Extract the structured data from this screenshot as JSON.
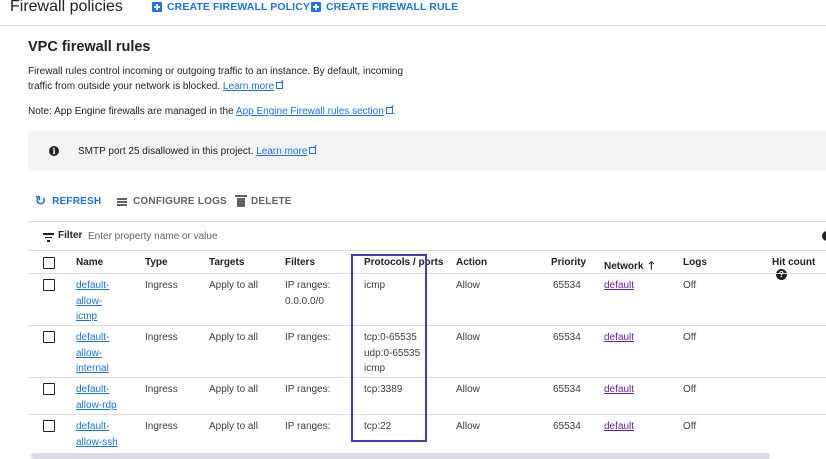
{
  "header": {
    "title": "Firewall policies",
    "create_policy_label": "CREATE FIREWALL POLICY",
    "create_rule_label": "CREATE FIREWALL RULE"
  },
  "section": {
    "title": "VPC firewall rules",
    "description_line1": "Firewall rules control incoming or outgoing traffic to an instance. By default, incoming",
    "description_line2": "traffic from outside your network is blocked.",
    "learn_more": "Learn more",
    "note_prefix": "Note: App Engine firewalls are managed in the",
    "note_link": "App Engine Firewall rules section",
    "note_suffix": "."
  },
  "banner": {
    "text": "SMTP port 25 disallowed in this project.",
    "learn_more": "Learn more"
  },
  "toolbar": {
    "refresh": "REFRESH",
    "configure_logs": "CONFIGURE LOGS",
    "delete": "DELETE"
  },
  "filter": {
    "label": "Filter",
    "placeholder": "Enter property name or value"
  },
  "table": {
    "columns": {
      "name": "Name",
      "type": "Type",
      "targets": "Targets",
      "filters": "Filters",
      "protocols": "Protocols / ports",
      "action": "Action",
      "priority": "Priority",
      "network": "Network",
      "logs": "Logs",
      "hit_count": "Hit count"
    },
    "rows": [
      {
        "name": [
          "default-",
          "allow-",
          "icmp"
        ],
        "type": "Ingress",
        "targets": "Apply to all",
        "filters": [
          "IP ranges:",
          "0.0.0.0/0"
        ],
        "protocols": [
          "icmp"
        ],
        "action": "Allow",
        "priority": "65534",
        "network": "default",
        "logs": "Off"
      },
      {
        "name": [
          "default-",
          "allow-",
          "internal"
        ],
        "type": "Ingress",
        "targets": "Apply to all",
        "filters": [
          "IP ranges:"
        ],
        "protocols": [
          "tcp:0-65535",
          "udp:0-65535",
          "icmp"
        ],
        "action": "Allow",
        "priority": "65534",
        "network": "default",
        "logs": "Off"
      },
      {
        "name": [
          "default-",
          "allow-rdp"
        ],
        "type": "Ingress",
        "targets": "Apply to all",
        "filters": [
          "IP ranges:"
        ],
        "protocols": [
          "tcp:3389"
        ],
        "action": "Allow",
        "priority": "65534",
        "network": "default",
        "logs": "Off"
      },
      {
        "name": [
          "default-",
          "allow-ssh"
        ],
        "type": "Ingress",
        "targets": "Apply to all",
        "filters": [
          "IP ranges:"
        ],
        "protocols": [
          "tcp:22"
        ],
        "action": "Allow",
        "priority": "65534",
        "network": "default",
        "logs": "Off"
      }
    ]
  },
  "colors": {
    "accent": "#1a73e8",
    "visited_link": "#681da8",
    "highlight_box": "#3f3bbf"
  }
}
